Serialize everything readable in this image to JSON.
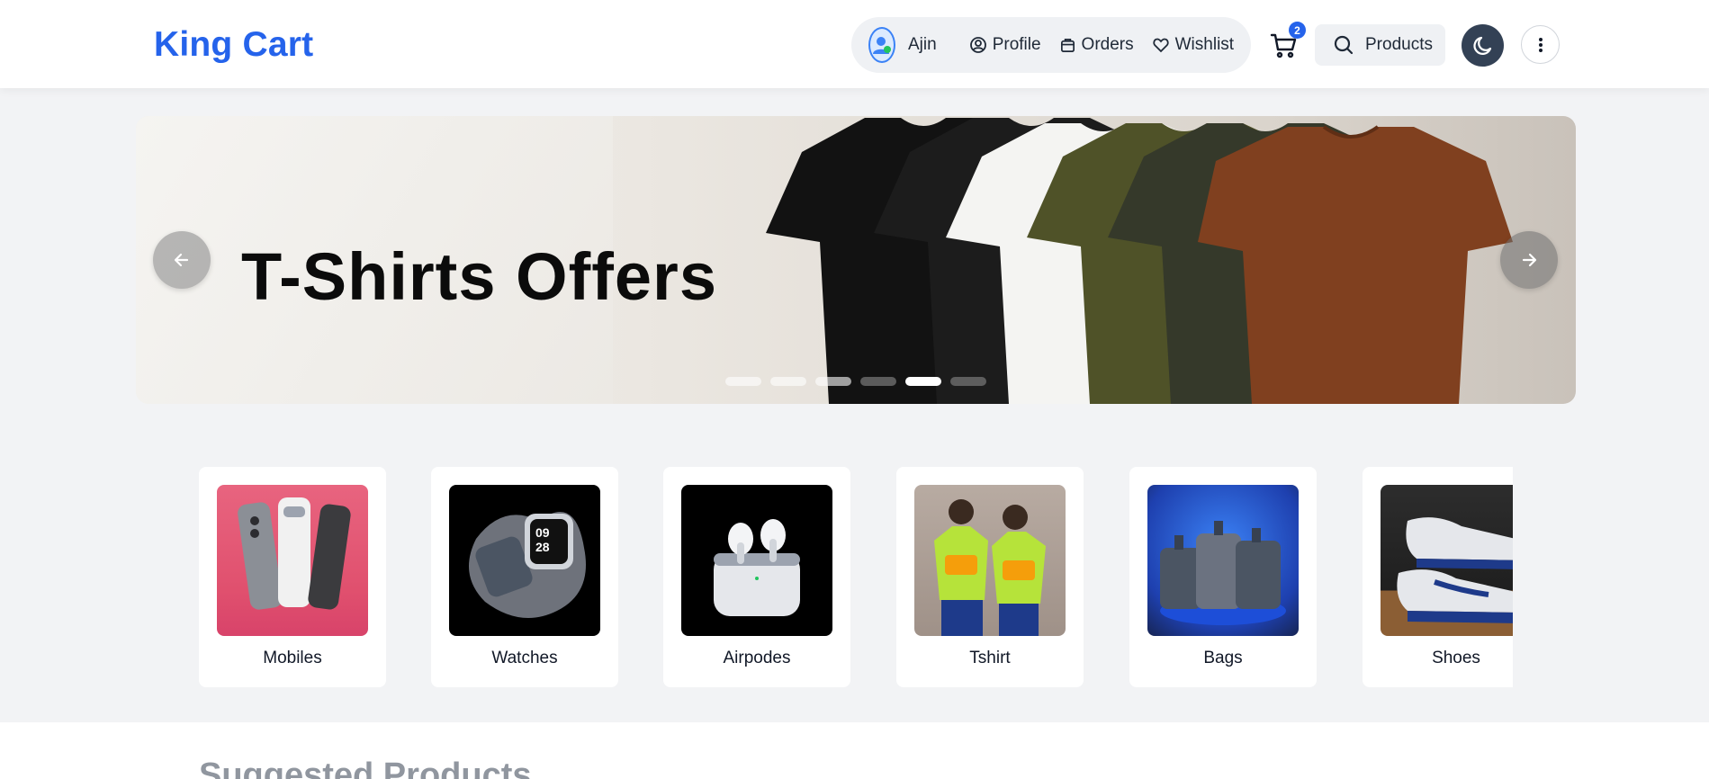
{
  "brand": {
    "name": "King Cart",
    "color": "#2563eb"
  },
  "header": {
    "user_name": "Ajin",
    "nav": [
      {
        "label": "Profile",
        "icon": "user-circle-icon"
      },
      {
        "label": "Orders",
        "icon": "bag-icon"
      },
      {
        "label": "Wishlist",
        "icon": "heart-icon"
      }
    ],
    "cart_count": "2",
    "search_label": "Products",
    "theme_icon": "moon-icon",
    "more_icon": "more-vertical-icon"
  },
  "banner": {
    "title": "T-Shirts Offers",
    "slide_count": 6,
    "active_slide": 5
  },
  "categories": [
    {
      "label": "Mobiles"
    },
    {
      "label": "Watches"
    },
    {
      "label": "Airpodes"
    },
    {
      "label": "Tshirt"
    },
    {
      "label": "Bags"
    },
    {
      "label": "Shoes"
    }
  ],
  "suggested": {
    "title": "Suggested Products"
  }
}
